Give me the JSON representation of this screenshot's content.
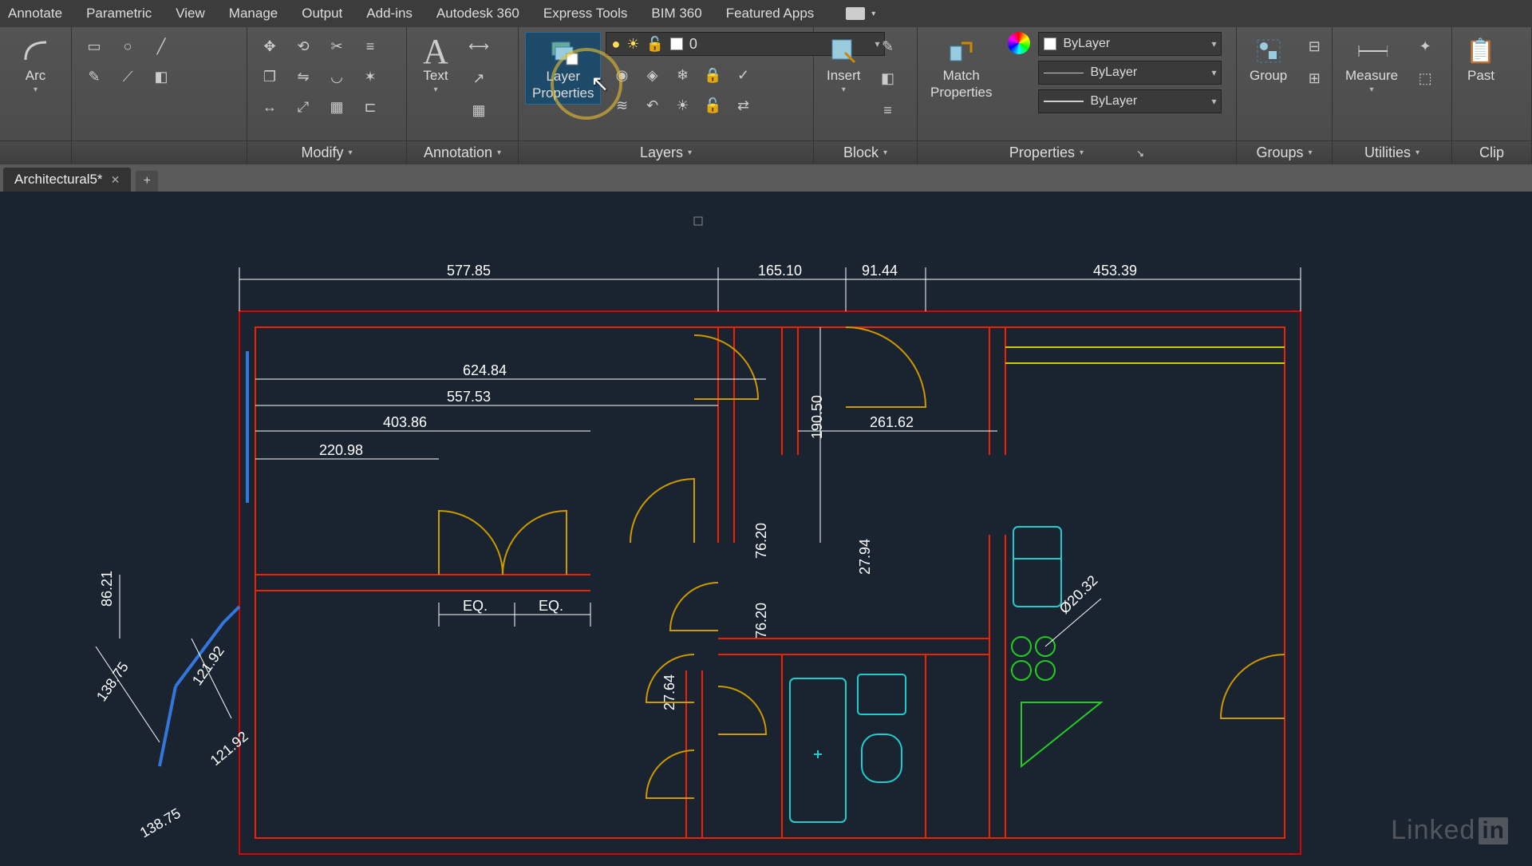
{
  "menubar": [
    "Annotate",
    "Parametric",
    "View",
    "Manage",
    "Output",
    "Add-ins",
    "Autodesk 360",
    "Express Tools",
    "BIM 360",
    "Featured Apps"
  ],
  "ribbon": {
    "draw": {
      "btn": "Arc"
    },
    "modify": {
      "title": "Modify"
    },
    "annotation": {
      "title": "Annotation",
      "btn": "Text"
    },
    "layers": {
      "title": "Layers",
      "btn1": "Layer",
      "btn2": "Properties",
      "current": "0"
    },
    "block": {
      "title": "Block",
      "btn": "Insert"
    },
    "properties": {
      "title": "Properties",
      "btn": "Match",
      "btn2": "Properties",
      "val": "ByLayer"
    },
    "groups": {
      "title": "Groups",
      "btn": "Group"
    },
    "utilities": {
      "title": "Utilities",
      "btn": "Measure"
    },
    "clip": {
      "title": "Clip",
      "btn": "Past"
    }
  },
  "tab": {
    "name": "Architectural5*"
  },
  "dims": {
    "top1": "577.85",
    "top2": "165.10",
    "top3": "91.44",
    "top4": "453.39",
    "h1": "624.84",
    "h2": "557.53",
    "h3": "403.86",
    "h4": "220.98",
    "eq": "EQ.",
    "v1": "190.50",
    "v2": "76.20",
    "v3": "27.94",
    "v4": "76.20",
    "v5": "27.64",
    "h5": "261.62",
    "diag": "Ø20.32",
    "left1": "86.21",
    "left2": "138.75",
    "left3": "121.92",
    "left4": "121.92",
    "left5": "138.75"
  },
  "watermark": "Linked"
}
